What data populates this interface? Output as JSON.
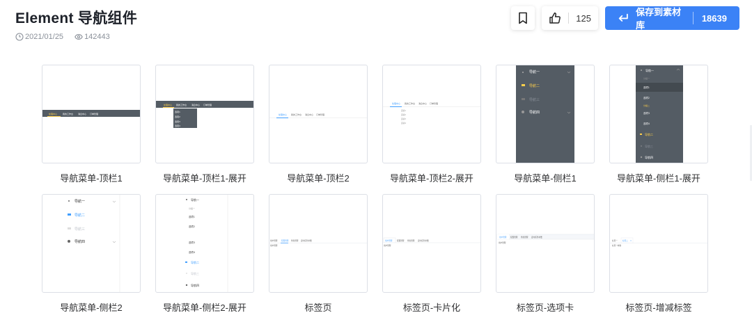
{
  "page": {
    "title": "Element 导航组件",
    "date": "2021/01/25",
    "views": "142443"
  },
  "actions": {
    "likes": "125",
    "save_label": "保存到素材库",
    "save_count": "18639"
  },
  "cards": [
    {
      "label": "导航菜单-顶栏1"
    },
    {
      "label": "导航菜单-顶栏1-展开"
    },
    {
      "label": "导航菜单-顶栏2"
    },
    {
      "label": "导航菜单-顶栏2-展开"
    },
    {
      "label": "导航菜单-侧栏1"
    },
    {
      "label": "导航菜单-侧栏1-展开"
    },
    {
      "label": "导航菜单-侧栏2"
    },
    {
      "label": "导航菜单-侧栏2-展开"
    },
    {
      "label": "标签页"
    },
    {
      "label": "标签页-卡片化"
    },
    {
      "label": "标签页-选项卡"
    },
    {
      "label": "标签页-增减标签"
    }
  ],
  "thumbs": {
    "topbar_items": [
      "处理中心",
      "我的工作台",
      "消息中心",
      "订单管理"
    ],
    "dropdown_items": [
      "选项1",
      "选项2",
      "选项3",
      "选项4"
    ],
    "side1_items": [
      "导航一",
      "导航二",
      "导航三",
      "导航四"
    ],
    "side1_expanded": [
      "导航一",
      "分组一",
      "选项1",
      "选项2",
      "分组二",
      "选项3",
      "选项4",
      "导航二",
      "导航三",
      "导航四"
    ],
    "side2_items": [
      "导航一",
      "导航二",
      "导航三",
      "导航四"
    ],
    "side2_expanded": [
      "导航一",
      "分组一",
      "选项1",
      "选项2",
      "选项3",
      "选项4",
      "导航二",
      "导航三",
      "导航四"
    ],
    "tabs": [
      "用户管理",
      "配置管理",
      "角色管理",
      "定时任务补偿"
    ],
    "tab_content": "用户管理",
    "tabs_edit": [
      "标签一",
      "标签二"
    ],
    "tabs_edit_content": "标签一内容"
  },
  "colors": {
    "accent": "#3b82f6",
    "nav_dark": "#545c64",
    "nav_active": "#ffd04b",
    "element_blue": "#409eff"
  }
}
